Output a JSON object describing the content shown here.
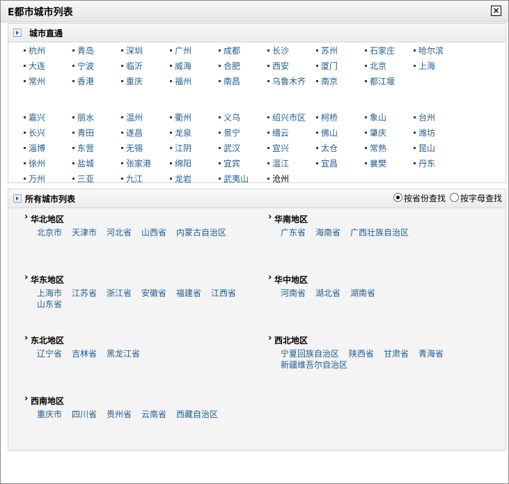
{
  "window": {
    "title": "E都市城市列表",
    "close_label": "×"
  },
  "direct": {
    "title": "城市直通",
    "row1": [
      "杭州",
      "青岛",
      "深圳",
      "广州",
      "成都",
      "长沙",
      "苏州",
      "石家庄",
      "哈尔滨"
    ],
    "row2": [
      "大连",
      "宁波",
      "临沂",
      "威海",
      "合肥",
      "西安",
      "厦门",
      "北京",
      "上海"
    ],
    "row3": [
      "常州",
      "香港",
      "重庆",
      "福州",
      "南昌",
      "乌鲁木齐",
      "南京",
      "都江堰"
    ],
    "row4": [
      "嘉兴",
      "丽水",
      "温州",
      "衢州",
      "义乌",
      "绍兴市区",
      "柯桥",
      "象山",
      "台州"
    ],
    "row5": [
      "长兴",
      "青田",
      "遂昌",
      "龙泉",
      "景宁",
      "缙云",
      "佛山",
      "肇庆",
      "潍坊"
    ],
    "row6": [
      "淄博",
      "东营",
      "无锡",
      "江阴",
      "武汉",
      "宜兴",
      "太仓",
      "常熟",
      "昆山"
    ],
    "row7": [
      "徐州",
      "盐城",
      "张家港",
      "绵阳",
      "宜宾",
      "温江",
      "宜昌",
      "襄樊",
      "丹东"
    ],
    "row8": [
      "万州",
      "三亚",
      "九江",
      "龙岩",
      "武夷山",
      "沧州"
    ]
  },
  "all": {
    "title": "所有城市列表",
    "by_province": "按省份查找",
    "by_letter": "按字母查找",
    "regions": [
      {
        "name": "华北地区",
        "items": [
          "北京市",
          "天津市",
          "河北省",
          "山西省",
          "内蒙古自治区"
        ]
      },
      {
        "name": "华南地区",
        "items": [
          "广东省",
          "海南省",
          "广西壮族自治区"
        ]
      },
      {
        "name": "华东地区",
        "items": [
          "上海市",
          "江苏省",
          "浙江省",
          "安徽省",
          "福建省",
          "江西省",
          "山东省"
        ]
      },
      {
        "name": "华中地区",
        "items": [
          "河南省",
          "湖北省",
          "湖南省"
        ]
      },
      {
        "name": "东北地区",
        "items": [
          "辽宁省",
          "吉林省",
          "黑龙江省"
        ]
      },
      {
        "name": "西北地区",
        "items": [
          "宁夏回族自治区",
          "陕西省",
          "甘肃省",
          "青海省",
          "新疆维吾尔自治区"
        ]
      },
      {
        "name": "西南地区",
        "items": [
          "重庆市",
          "四川省",
          "贵州省",
          "云南省",
          "西藏自治区"
        ]
      }
    ]
  }
}
